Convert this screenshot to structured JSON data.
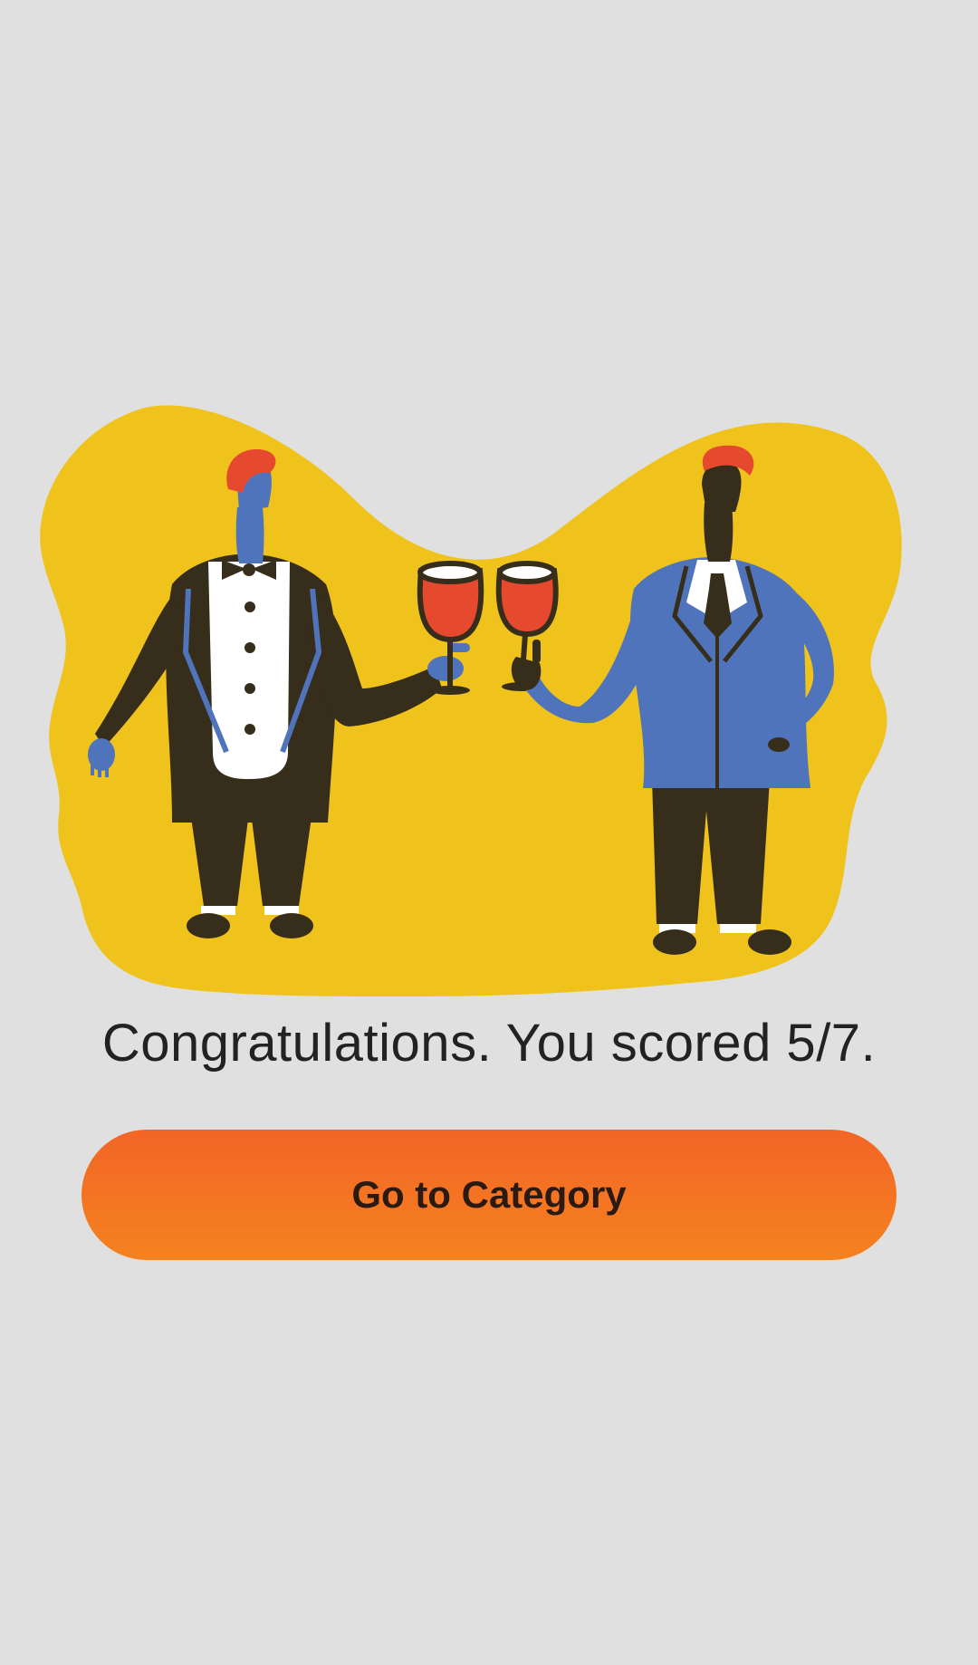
{
  "result": {
    "message": "Congratulations. You scored 5/7.",
    "score": 5,
    "total": 7
  },
  "actions": {
    "go_to_category_label": "Go to Category"
  },
  "illustration": {
    "icon": "toasting-people-illustration",
    "colors": {
      "background": "#e0e0e0",
      "blob": "#efc31b",
      "suit_dark": "#362d1a",
      "suit_blue": "#4f74bb",
      "hair": "#e64a2e",
      "wine": "#e64a2e",
      "shirt": "#ffffff",
      "button_gradient_top": "#f26527",
      "button_gradient_bottom": "#f5821f"
    }
  }
}
